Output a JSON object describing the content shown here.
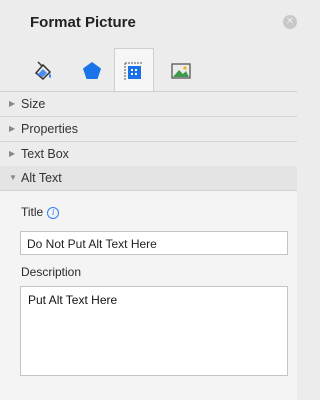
{
  "panel_title": "Format Picture",
  "close_icon": "close-icon",
  "tabs": [
    {
      "icon": "fill-line-icon",
      "active": false
    },
    {
      "icon": "effects-pentagon-icon",
      "active": false
    },
    {
      "icon": "size-properties-icon",
      "active": true
    },
    {
      "icon": "picture-icon",
      "active": false
    }
  ],
  "sections": [
    {
      "label": "Size",
      "expanded": false
    },
    {
      "label": "Properties",
      "expanded": false
    },
    {
      "label": "Text Box",
      "expanded": false
    },
    {
      "label": "Alt Text",
      "expanded": true
    }
  ],
  "alt_text": {
    "title_label": "Title",
    "title_value": "Do Not Put Alt Text Here",
    "description_label": "Description",
    "description_value": "Put Alt Text Here"
  },
  "colors": {
    "accent": "#2f7ef5",
    "active_tab_icon": "#1a73e8",
    "panel_bg": "#ececec"
  }
}
